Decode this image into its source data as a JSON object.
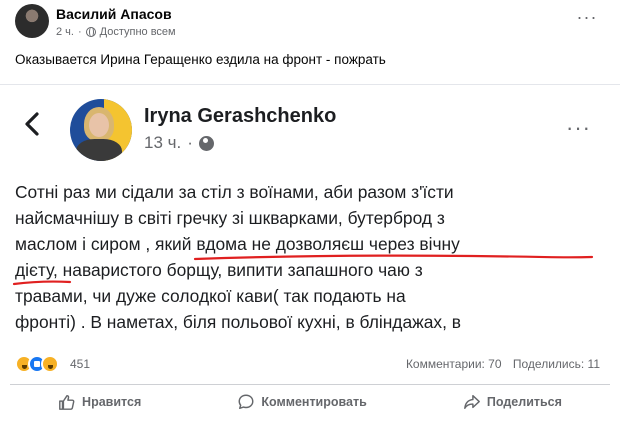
{
  "post": {
    "author": "Василий Апасов",
    "time": "2 ч.",
    "separator": "·",
    "audience": "Доступно всем",
    "more": "···",
    "caption": "Оказывается Ирина Геращенко ездила на фронт - пожрать"
  },
  "shared": {
    "author": "Iryna Gerashchenko",
    "time": "13 ч.",
    "separator": "·",
    "more": "···",
    "lines": [
      "Сотні раз ми сідали за стіл з воїнами, аби разом з'їсти",
      "найсмачнішу в світі гречку зі шкварками, бутерброд з",
      "маслом і сиром , ",
      "який вдома не дозволяєш через вічну",
      "дієту",
      ", наваристого борщу, випити запашного чаю з",
      "травами, чи дуже солодкої кави( так подають на",
      "фронті) . В наметах, біля польової кухні, в бліндажах, в"
    ]
  },
  "reactions": {
    "icons": [
      "haha-icon",
      "like-icon",
      "wow-icon"
    ],
    "count": "451",
    "comments": "Комментарии: 70",
    "shares": "Поделились: 11"
  },
  "actions": {
    "like": "Нравится",
    "comment": "Комментировать",
    "share": "Поделиться"
  },
  "colors": {
    "underline": "#e02020",
    "muted": "#65676b"
  }
}
